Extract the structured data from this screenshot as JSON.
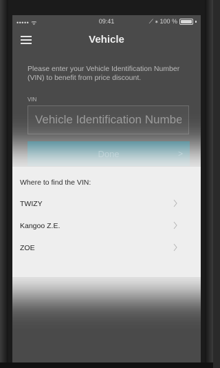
{
  "status_bar": {
    "signal": "••••• ᯤ",
    "time": "09:41",
    "battery_text": "⟋ ∗ 100 %"
  },
  "header": {
    "title": "Vehicle"
  },
  "form": {
    "intro": "Please enter your Vehicle Identification Number (VIN) to benefit from price discount.",
    "vin_label": "VIN",
    "vin_placeholder": "Vehicle Identification Number",
    "done_label": "Done"
  },
  "find_vin": {
    "title": "Where to find the VIN:",
    "items": [
      {
        "label": "TWIZY"
      },
      {
        "label": "Kangoo Z.E."
      },
      {
        "label": "ZOE"
      }
    ]
  }
}
